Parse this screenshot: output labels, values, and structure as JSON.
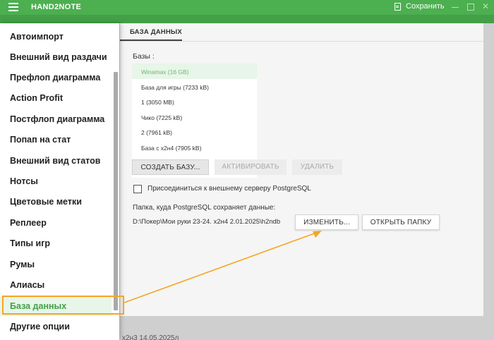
{
  "app": {
    "title": "HAND2NOTE",
    "save_label": "Сохранить"
  },
  "sidebar": {
    "items": [
      {
        "label": "Автоимпорт"
      },
      {
        "label": "Внешний вид раздачи"
      },
      {
        "label": "Префлоп диаграмма"
      },
      {
        "label": "Action Profit"
      },
      {
        "label": "Постфлоп диаграмма"
      },
      {
        "label": "Попап на стат"
      },
      {
        "label": "Внешний вид статов"
      },
      {
        "label": "Нотсы"
      },
      {
        "label": "Цветовые метки"
      },
      {
        "label": "Реплеер"
      },
      {
        "label": "Типы игр"
      },
      {
        "label": "Румы"
      },
      {
        "label": "Алиасы"
      },
      {
        "label": "База данных"
      },
      {
        "label": "Другие опции"
      }
    ],
    "active_index": 13
  },
  "main": {
    "tab": "БАЗА ДАННЫХ",
    "bases_label": "Базы :",
    "databases": [
      "Winamax (16 GB)",
      "База для игры (7233 kB)",
      "1 (3050 MB)",
      "Чико (7225 kB)",
      "2 (7961 kB)",
      "База с x2н4 (7905 kB)"
    ],
    "selected_database": 0,
    "buttons": {
      "create": "СОЗДАТЬ БАЗУ...",
      "activate": "АКТИВИРОВАТЬ",
      "delete": "УДАЛИТЬ",
      "change": "ИЗМЕНИТЬ...",
      "open_folder": "ОТКРЫТЬ ПАПКУ"
    },
    "external_server_label": "Присоединиться к внешнему серверу PostgreSQL",
    "external_server_checked": false,
    "folder_label": "Папка, куда PostgreSQL сохраняет данные:",
    "folder_path": "D:\\Покер\\Мои руки 23-24. x2н4 2.01.2025\\h2ndb",
    "bottom_text": "x2н3  14.05.2025л"
  },
  "colors": {
    "titlebar": "#4caf50",
    "accent": "#43a047",
    "highlight_border": "#f5a623"
  }
}
